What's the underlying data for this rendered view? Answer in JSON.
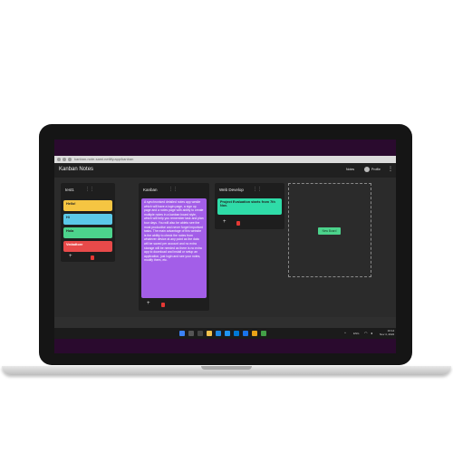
{
  "browser": {
    "url": "kanban-note-sami.netlify.app/kanban"
  },
  "app": {
    "title": "Kanban Notes",
    "nav_notes": "Notes",
    "nav_profile": "Profile",
    "menu_icon": "more-vertical-icon"
  },
  "columns": [
    {
      "title": "test1",
      "cards": [
        {
          "text": "Hello!",
          "color": "#f5c542"
        },
        {
          "text": "Hi",
          "color": "#5bc8e8"
        },
        {
          "text": "Hola",
          "color": "#4cd38c"
        },
        {
          "text": "Vedadtore",
          "color": "#e84a4a"
        }
      ]
    },
    {
      "title": "Kanban",
      "cards": [
        {
          "text": "A synchronised detailed notes app wesite which will have a login page, a sign up page and a notes page with ability to create multiple notes in a kanban board style, which will help you remember task and plan tour days. You will also be ableto see the most productive and never forget important tasks. The main advantage of this website is the ability to check the notes from whatever device at any point as the data will be saved per account and no extra storage will be needed as there is no extra app to download and install or setup an application, just login and see your notes, modify them, etc.",
          "color": "#a35ee8"
        }
      ]
    },
    {
      "title": "Web Develop",
      "cards": [
        {
          "text": "Project Evaluation starts from 7th Nov.",
          "color": "#2fdca8"
        }
      ]
    }
  ],
  "new_board_label": "New Board",
  "taskbar": {
    "time": "10:14",
    "date": "Nov 4, 2022",
    "tray_lang": "ENG"
  }
}
